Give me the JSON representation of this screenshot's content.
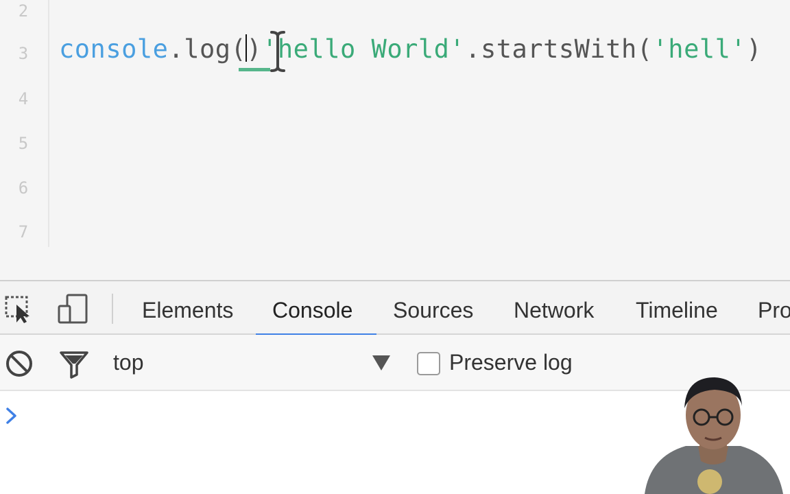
{
  "editor": {
    "line_numbers": [
      "2",
      "3",
      "4",
      "5",
      "6",
      "7"
    ],
    "code": {
      "identifier": "console",
      "dot1": ".",
      "method": "log",
      "paren_open": "(",
      "paren_close": ")",
      "string1": "'hello World'",
      "dot2": ".",
      "call": "startsWith",
      "paren_open2": "(",
      "string2": "'hell'",
      "paren_close2": ")"
    }
  },
  "devtools": {
    "tabs": [
      "Elements",
      "Console",
      "Sources",
      "Network",
      "Timeline",
      "Pro"
    ],
    "active_tab": "Console",
    "context": "top",
    "preserve_log_label": "Preserve log",
    "preserve_log_checked": false,
    "accent_color": "#3f80e6"
  },
  "icons": {
    "inspect": "inspect-element-icon",
    "device": "device-toolbar-icon",
    "clear": "clear-console-icon",
    "filter": "filter-icon",
    "prompt": "console-prompt-icon"
  }
}
